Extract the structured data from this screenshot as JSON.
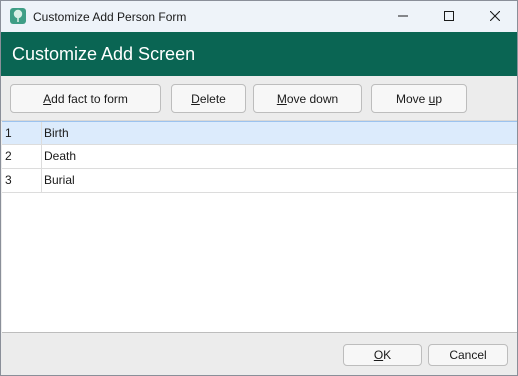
{
  "window": {
    "title": "Customize Add Person Form",
    "icon": "tree-app-icon",
    "controls": [
      "minimize-icon",
      "maximize-icon",
      "close-icon"
    ]
  },
  "header": {
    "title": "Customize Add Screen",
    "background": "#0a6553"
  },
  "toolbar": {
    "add_fact": {
      "pre": "",
      "key": "A",
      "post": "dd fact to form"
    },
    "delete": {
      "pre": "",
      "key": "D",
      "post": "elete"
    },
    "move_down": {
      "pre": "",
      "key": "M",
      "post": "ove down"
    },
    "move_up": {
      "pre": "Move ",
      "key": "u",
      "post": "p"
    }
  },
  "facts": [
    {
      "num": "1",
      "name": "Birth",
      "selected": true
    },
    {
      "num": "2",
      "name": "Death",
      "selected": false
    },
    {
      "num": "3",
      "name": "Burial",
      "selected": false
    }
  ],
  "footer": {
    "ok": {
      "pre": "",
      "key": "O",
      "post": "K"
    },
    "cancel": "Cancel"
  }
}
